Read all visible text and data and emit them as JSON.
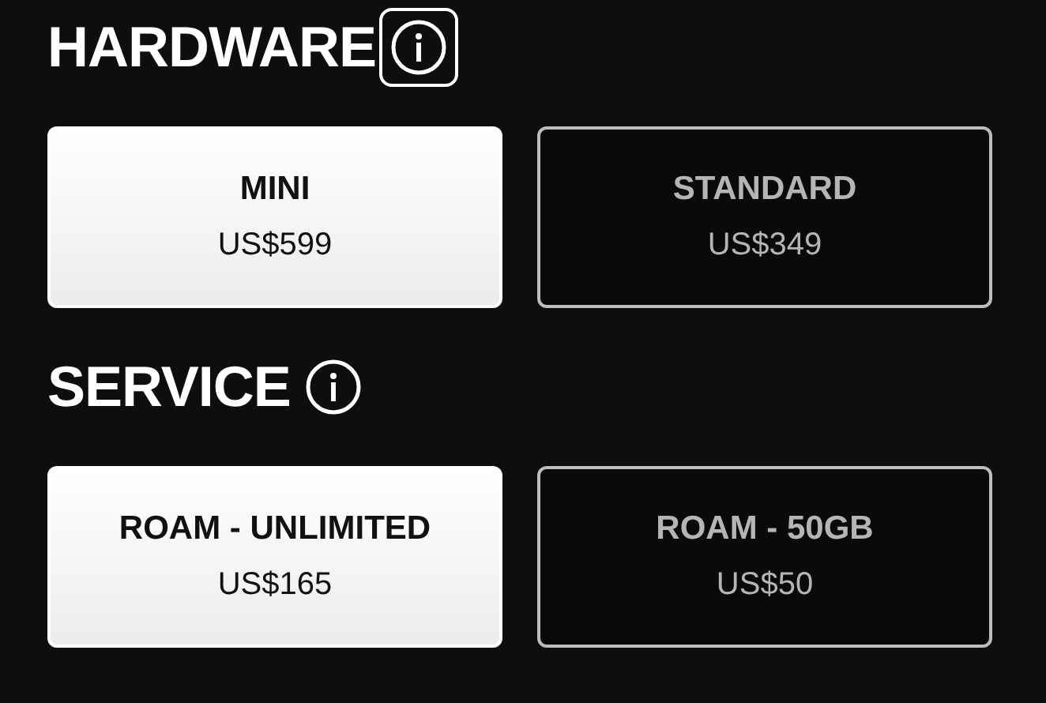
{
  "sections": [
    {
      "title": "HARDWARE",
      "info_focused": true,
      "options": [
        {
          "name": "MINI",
          "price": "US$599",
          "selected": true
        },
        {
          "name": "STANDARD",
          "price": "US$349",
          "selected": false
        }
      ]
    },
    {
      "title": "SERVICE",
      "info_focused": false,
      "options": [
        {
          "name": "ROAM - UNLIMITED",
          "price": "US$165",
          "selected": true
        },
        {
          "name": "ROAM - 50GB",
          "price": "US$50",
          "selected": false
        }
      ]
    }
  ]
}
